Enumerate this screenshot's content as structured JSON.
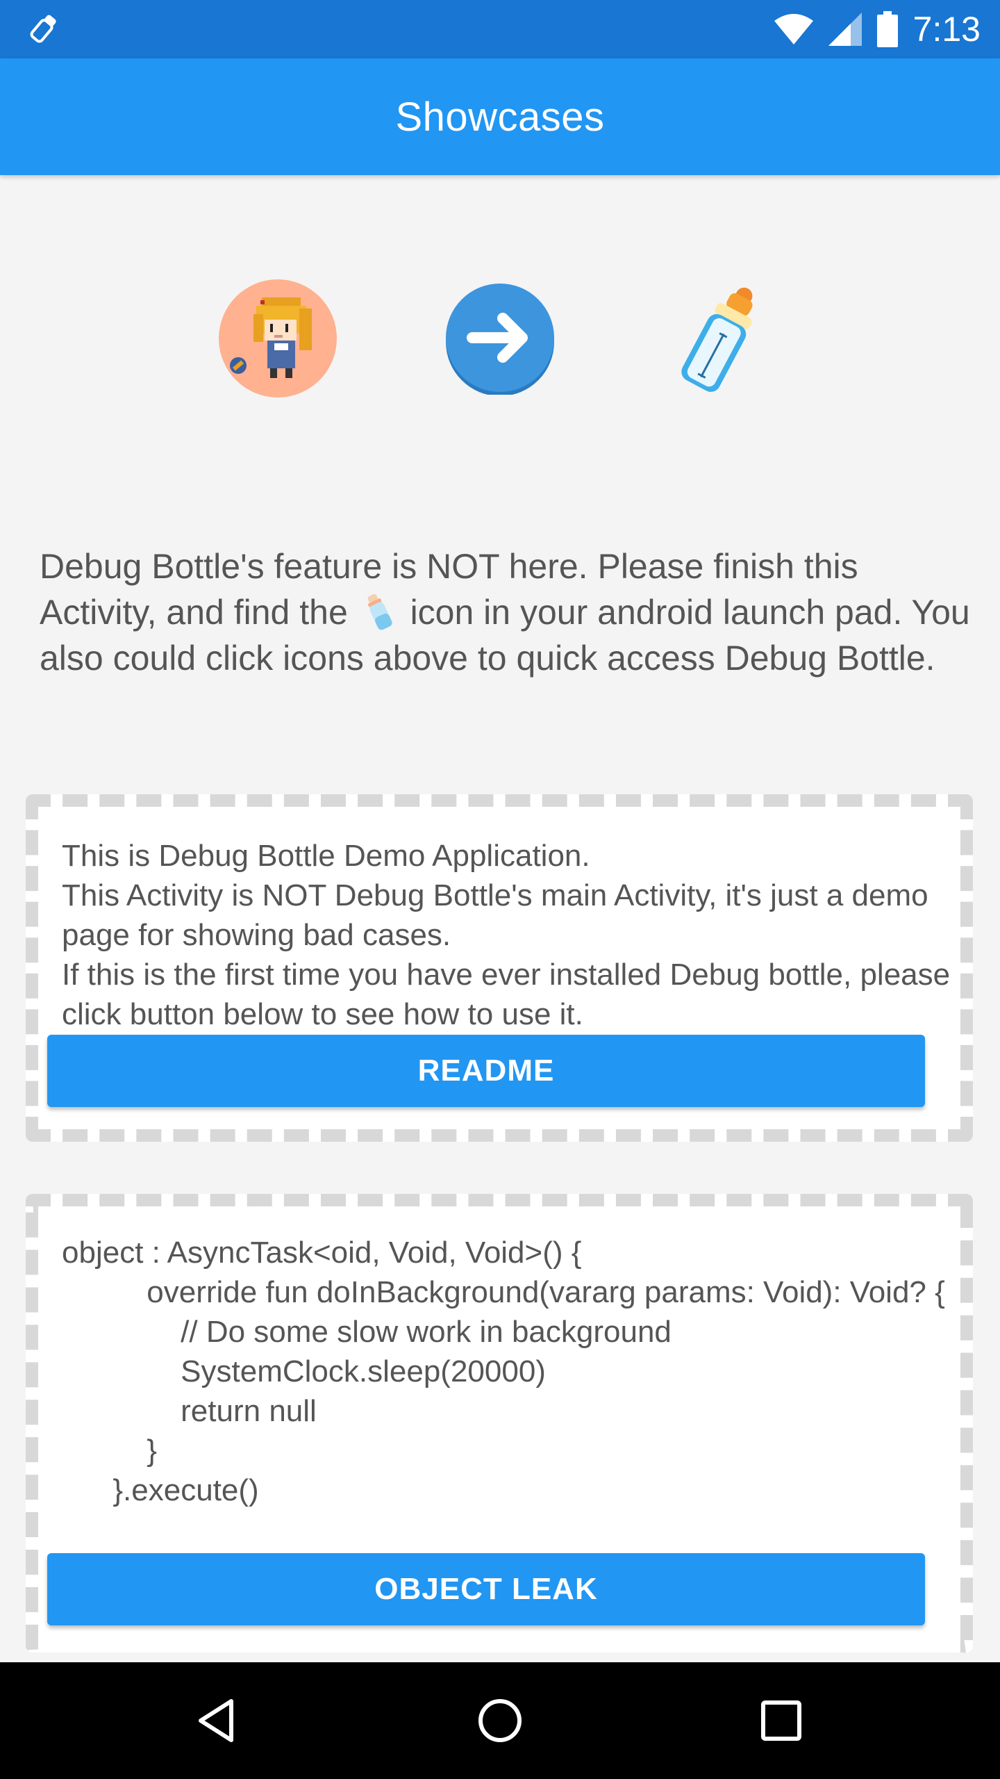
{
  "status_bar": {
    "time": "7:13",
    "left_icon": "bottle-notification-icon",
    "icons": [
      "wifi-icon",
      "signal-icon",
      "battery-icon"
    ]
  },
  "app_bar": {
    "title": "Showcases"
  },
  "showcase_icons": [
    "pixel-avatar-icon",
    "arrow-right-icon",
    "baby-bottle-icon"
  ],
  "description": {
    "part1": "Debug Bottle's feature is NOT here. Please finish this Activity, and find the",
    "part2": "icon in your android launch pad. You also could click icons above to quick access Debug Bottle."
  },
  "card_readme": {
    "text": "This is Debug Bottle Demo Application.\nThis Activity is NOT Debug Bottle's main Activity, it's just a demo page for showing bad cases.\nIf this is the first time you have ever installed Debug bottle, please click button below to see how to use it.",
    "button_label": "README"
  },
  "card_leak": {
    "code": "object : AsyncTask<oid, Void, Void>() {\n          override fun doInBackground(vararg params: Void): Void? {\n              // Do some slow work in background\n              SystemClock.sleep(20000)\n              return null\n          }\n      }.execute()",
    "button_label": "OBJECT LEAK"
  },
  "nav_bar": {
    "buttons": [
      "back-icon",
      "home-icon",
      "recent-apps-icon"
    ]
  },
  "colors": {
    "status_bar": "#1976D2",
    "app_bar": "#2196F3",
    "button": "#2196F3",
    "background": "#f4f4f4"
  }
}
